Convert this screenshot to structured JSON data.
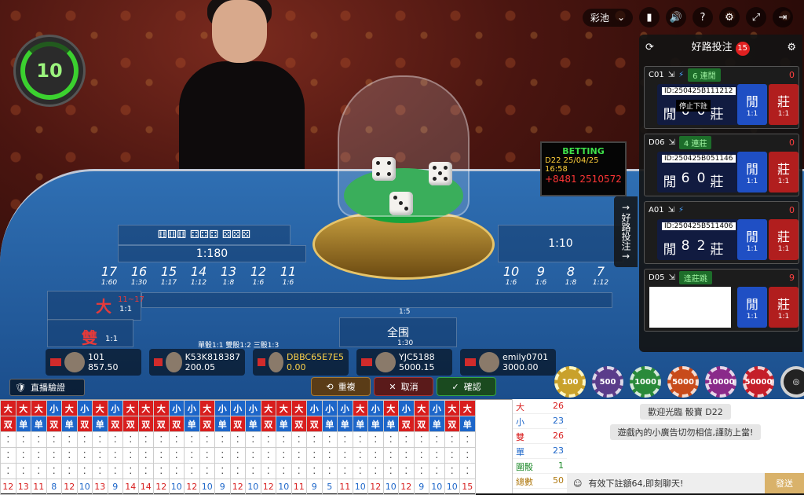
{
  "app": {
    "pool_label": "彩池"
  },
  "timer": {
    "seconds": "10"
  },
  "sign": {
    "status": "BETTING",
    "table_time": "D22 25/04/25 16:58",
    "phone": "+8481 2510572"
  },
  "sidebar": {
    "title": "好路投注",
    "count": "15",
    "tab_label": "好路投注"
  },
  "roads": [
    {
      "table": "C01",
      "tag": "6 連閒",
      "count": "0",
      "id": "ID:250425B111212",
      "score": [
        "閒",
        "6",
        "0",
        "莊"
      ],
      "note": "停止下註",
      "player": "閒",
      "banker": "莊",
      "odds": "1:1"
    },
    {
      "table": "D06",
      "tag": "4 連莊",
      "count": "0",
      "id": "ID:250425B051146",
      "score": [
        "閒",
        "6",
        "0",
        "莊"
      ],
      "player": "閒",
      "banker": "莊",
      "odds": "1:1"
    },
    {
      "table": "A01",
      "tag": "",
      "count": "0",
      "id": "ID:250425B511406",
      "score": [
        "閒",
        "8",
        "2",
        "莊"
      ],
      "player": "閒",
      "banker": "莊",
      "odds": "1:1"
    },
    {
      "table": "D05",
      "tag": "逢莊跳",
      "count": "9",
      "player": "閒",
      "banker": "莊",
      "odds": "1:1"
    }
  ],
  "board": {
    "big": "大",
    "big_range": "11~17",
    "big_odds": "1:1",
    "even": "雙",
    "even_odds": "1:1",
    "odds_line": "單骰1:1 雙骰1:2 三骰1:3",
    "all": "全围",
    "all_odds": "1:30",
    "mid_odds": "1:5",
    "sums": [
      {
        "n": "17",
        "o": "1:60"
      },
      {
        "n": "16",
        "o": "1:30"
      },
      {
        "n": "15",
        "o": "1:17"
      },
      {
        "n": "14",
        "o": "1:12"
      },
      {
        "n": "13",
        "o": "1:8"
      },
      {
        "n": "12",
        "o": "1:6"
      },
      {
        "n": "11",
        "o": "1:6"
      }
    ],
    "sums_right": [
      {
        "n": "10",
        "o": "1:6"
      },
      {
        "n": "9",
        "o": "1:6"
      },
      {
        "n": "8",
        "o": "1:8"
      },
      {
        "n": "7",
        "o": "1:12"
      }
    ],
    "odds_180": "1:180",
    "odds_10": "1:10"
  },
  "players": [
    {
      "name": "101",
      "value": "857.50"
    },
    {
      "name": "K53K818387",
      "value": "200.05"
    },
    {
      "name": "DBBC65E7E5",
      "value": "0.00"
    },
    {
      "name": "YJC5188",
      "value": "5000.15"
    },
    {
      "name": "emily0701",
      "value": "3000.00"
    }
  ],
  "controls": {
    "live": "直播驗證",
    "repeat": "重複",
    "cancel": "取消",
    "confirm": "確認"
  },
  "chips": [
    "100",
    "500",
    "1000",
    "5000",
    "10000",
    "50000"
  ],
  "road_rows": {
    "bs": [
      "大",
      "大",
      "大",
      "小",
      "大",
      "小",
      "大",
      "小",
      "大",
      "大",
      "大",
      "小",
      "小",
      "大",
      "小",
      "小",
      "小",
      "大",
      "大",
      "大",
      "小",
      "小",
      "小",
      "大",
      "小",
      "大",
      "小",
      "大",
      "小",
      "大",
      "大"
    ],
    "oe": [
      "双",
      "单",
      "单",
      "双",
      "单",
      "双",
      "单",
      "双",
      "双",
      "双",
      "双",
      "双",
      "单",
      "双",
      "单",
      "双",
      "单",
      "双",
      "单",
      "双",
      "双",
      "单",
      "单",
      "单",
      "单",
      "单",
      "双",
      "双",
      "单",
      "双",
      "单"
    ],
    "totals": [
      "12",
      "13",
      "11",
      "8",
      "12",
      "10",
      "13",
      "9",
      "14",
      "14",
      "12",
      "10",
      "12",
      "10",
      "9",
      "12",
      "10",
      "12",
      "10",
      "11",
      "9",
      "5",
      "11",
      "10",
      "12",
      "10",
      "12",
      "9",
      "10",
      "10",
      "15"
    ]
  },
  "stats": [
    {
      "label": "大",
      "value": "26",
      "color": "#d81e1e"
    },
    {
      "label": "小",
      "value": "23",
      "color": "#1d66c9"
    },
    {
      "label": "雙",
      "value": "26",
      "color": "#d81e1e"
    },
    {
      "label": "單",
      "value": "23",
      "color": "#1d66c9"
    },
    {
      "label": "圍骰",
      "value": "1",
      "color": "#1d8a2a"
    },
    {
      "label": "總數",
      "value": "50",
      "color": "#b07a12"
    }
  ],
  "chat": {
    "msg1": "歡迎光臨 骰寶 D22",
    "msg2": "遊戲內的小廣告切勿相信,謹防上當!",
    "input": "有效下註額64,即刻聊天!",
    "send": "發送"
  }
}
